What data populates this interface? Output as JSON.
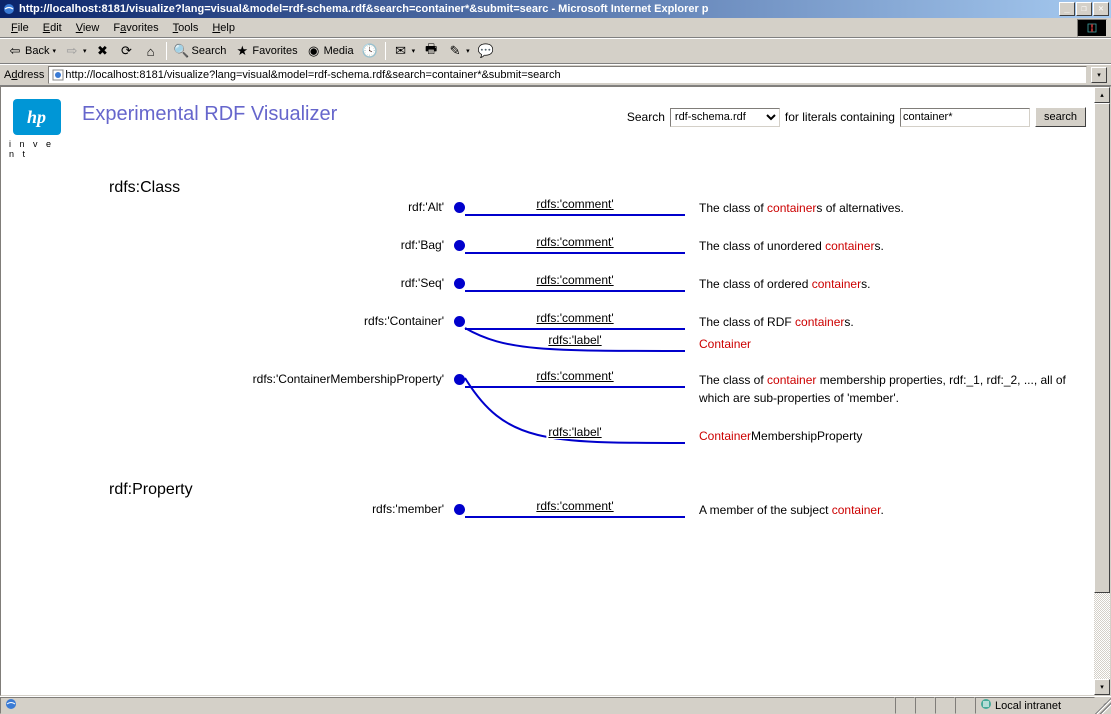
{
  "window": {
    "title": "http://localhost:8181/visualize?lang=visual&model=rdf-schema.rdf&search=container*&submit=searc - Microsoft Internet Explorer p"
  },
  "menubar": {
    "items": [
      {
        "accel": "F",
        "rest": "ile"
      },
      {
        "accel": "E",
        "rest": "dit"
      },
      {
        "accel": "V",
        "rest": "iew"
      },
      {
        "accel": "F",
        "rest": "avorites",
        "pre": ""
      },
      {
        "accel": "T",
        "rest": "ools"
      },
      {
        "accel": "H",
        "rest": "elp"
      }
    ]
  },
  "toolbar": {
    "back": "Back",
    "search": "Search",
    "favorites": "Favorites",
    "media": "Media"
  },
  "addressbar": {
    "label": "Address",
    "value": "http://localhost:8181/visualize?lang=visual&model=rdf-schema.rdf&search=container*&submit=search"
  },
  "page": {
    "logo_text": "hp",
    "logo_tagline": "i n v e n t",
    "title": "Experimental RDF Visualizer",
    "search_label": "Search",
    "search_model": "rdf-schema.rdf",
    "search_mid": "for literals containing",
    "search_value": "container*",
    "search_button": "search"
  },
  "sections": [
    {
      "heading": "rdfs:Class",
      "subjects": [
        {
          "name": "rdf:'Alt'",
          "edges": [
            {
              "label": "rdfs:'comment'",
              "object_pre": "The class of ",
              "object_hl": "container",
              "object_post": "s of alternatives."
            }
          ]
        },
        {
          "name": "rdf:'Bag'",
          "edges": [
            {
              "label": "rdfs:'comment'",
              "object_pre": "The class of unordered ",
              "object_hl": "container",
              "object_post": "s."
            }
          ]
        },
        {
          "name": "rdf:'Seq'",
          "edges": [
            {
              "label": "rdfs:'comment'",
              "object_pre": "The class of ordered ",
              "object_hl": "container",
              "object_post": "s."
            }
          ]
        },
        {
          "name": "rdfs:'Container'",
          "edges": [
            {
              "label": "rdfs:'comment'",
              "object_pre": "The class of RDF ",
              "object_hl": "container",
              "object_post": "s."
            },
            {
              "label": "rdfs:'label'",
              "object_pre": "",
              "object_hl": "Container",
              "object_post": ""
            }
          ]
        },
        {
          "name": "rdfs:'ContainerMembershipProperty'",
          "edges": [
            {
              "label": "rdfs:'comment'",
              "object_pre": "The class of ",
              "object_hl": "container",
              "object_post": " membership properties, rdf:_1, rdf:_2, ..., all of which are sub-properties of 'member'."
            },
            {
              "label": "rdfs:'label'",
              "object_pre": "",
              "object_hl": "Container",
              "object_post": "MembershipProperty"
            }
          ]
        }
      ]
    },
    {
      "heading": "rdf:Property",
      "subjects": [
        {
          "name": "rdfs:'member'",
          "edges": [
            {
              "label": "rdfs:'comment'",
              "object_pre": "A member of the subject ",
              "object_hl": "container",
              "object_post": "."
            }
          ]
        }
      ]
    }
  ],
  "statusbar": {
    "zone": "Local intranet"
  }
}
